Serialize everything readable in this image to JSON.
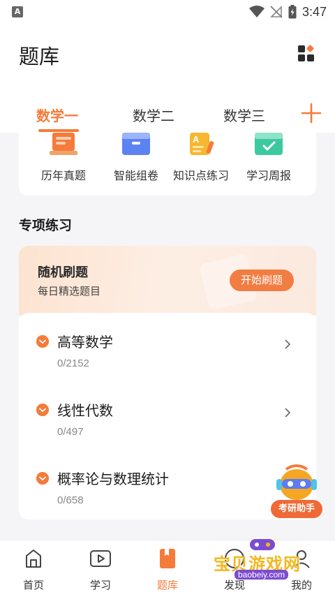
{
  "status": {
    "notification_badge": "A",
    "time": "3:47"
  },
  "header": {
    "title": "题库"
  },
  "tabs": [
    {
      "label": "数学一",
      "active": true
    },
    {
      "label": "数学二",
      "active": false
    },
    {
      "label": "数学三",
      "active": false
    }
  ],
  "tools": [
    {
      "label": "历年真题",
      "icon": "past-papers-icon"
    },
    {
      "label": "智能组卷",
      "icon": "smart-paper-icon"
    },
    {
      "label": "知识点练习",
      "icon": "knowledge-practice-icon"
    },
    {
      "label": "学习周报",
      "icon": "weekly-report-icon"
    }
  ],
  "practice": {
    "section_title": "专项练习",
    "banner_title": "随机刷题",
    "banner_subtitle": "每日精选题目",
    "start_button": "开始刷题",
    "subjects": [
      {
        "name": "高等数学",
        "count": "0/2152"
      },
      {
        "name": "线性代数",
        "count": "0/497"
      },
      {
        "name": "概率论与数理统计",
        "count": "0/658"
      }
    ]
  },
  "assistant": {
    "label": "考研助手"
  },
  "bottom_nav": [
    {
      "label": "首页",
      "icon": "home-icon",
      "active": false
    },
    {
      "label": "学习",
      "icon": "video-play-icon",
      "active": false
    },
    {
      "label": "题库",
      "icon": "question-bank-icon",
      "active": true
    },
    {
      "label": "发现",
      "icon": "discover-icon",
      "active": false
    },
    {
      "label": "我的",
      "icon": "profile-icon",
      "active": false
    }
  ],
  "watermark": {
    "text": "宝贝游戏网",
    "url": "baobeiy.com"
  },
  "colors": {
    "accent": "#f57b3a",
    "button": "#f27d42",
    "background": "#f5f5f7"
  }
}
